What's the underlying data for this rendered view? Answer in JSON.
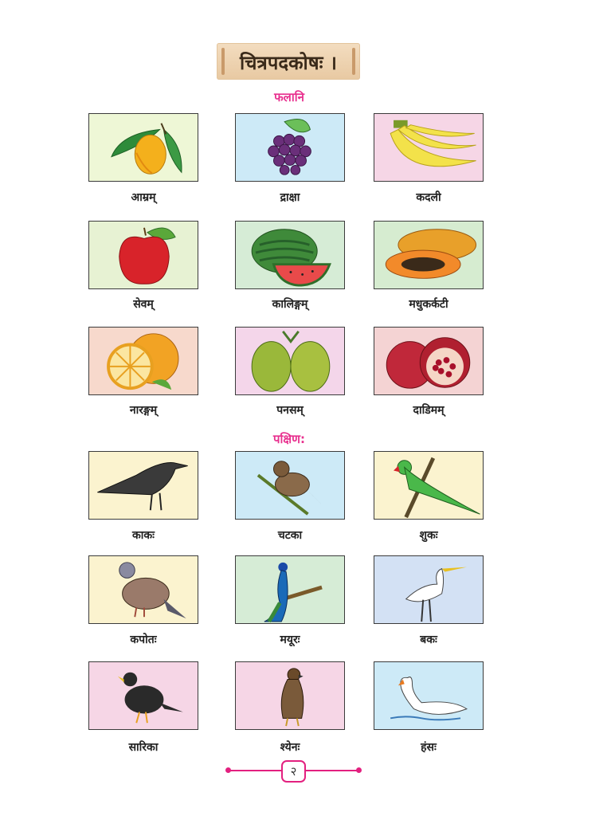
{
  "title": "चित्रपदकोषः ।",
  "sections": {
    "fruits": {
      "heading": "फलानि",
      "items": [
        {
          "label": "आम्रम्",
          "icon": "mango-icon",
          "bg": "#eef7d6"
        },
        {
          "label": "द्राक्षा",
          "icon": "grapes-icon",
          "bg": "#cdeaf7"
        },
        {
          "label": "कदली",
          "icon": "banana-icon",
          "bg": "#f6d6e6"
        },
        {
          "label": "सेवम्",
          "icon": "apple-icon",
          "bg": "#e7f2d3"
        },
        {
          "label": "कालिङ्गम्",
          "icon": "watermelon-icon",
          "bg": "#d6ecd6"
        },
        {
          "label": "मधुकर्कटी",
          "icon": "papaya-icon",
          "bg": "#d6ecd0"
        },
        {
          "label": "नारङ्गम्",
          "icon": "orange-icon",
          "bg": "#f7d9cc"
        },
        {
          "label": "पनसम्",
          "icon": "jackfruit-icon",
          "bg": "#f4d6ea"
        },
        {
          "label": "दाडिमम्",
          "icon": "pomegranate-icon",
          "bg": "#f4d3d3"
        }
      ]
    },
    "birds": {
      "heading": "पक्षिण:",
      "items": [
        {
          "label": "काकः",
          "icon": "crow-icon",
          "bg": "#fbf3cf"
        },
        {
          "label": "चटका",
          "icon": "sparrow-icon",
          "bg": "#cdeaf7"
        },
        {
          "label": "शुकः",
          "icon": "parrot-icon",
          "bg": "#fbf3cf"
        },
        {
          "label": "कपोतः",
          "icon": "pigeon-icon",
          "bg": "#fbf3cf"
        },
        {
          "label": "मयूरः",
          "icon": "peacock-icon",
          "bg": "#d6ecd6"
        },
        {
          "label": "बकः",
          "icon": "crane-icon",
          "bg": "#d3e1f4"
        },
        {
          "label": "सारिका",
          "icon": "myna-icon",
          "bg": "#f6d6e6"
        },
        {
          "label": "श्येनः",
          "icon": "hawk-icon",
          "bg": "#f6d6e6"
        },
        {
          "label": "हंसः",
          "icon": "swan-icon",
          "bg": "#cdeaf7"
        }
      ]
    }
  },
  "footer": {
    "page_number": "२"
  },
  "colors": {
    "heading": "#e8318f",
    "footer_accent": "#e3207f"
  }
}
